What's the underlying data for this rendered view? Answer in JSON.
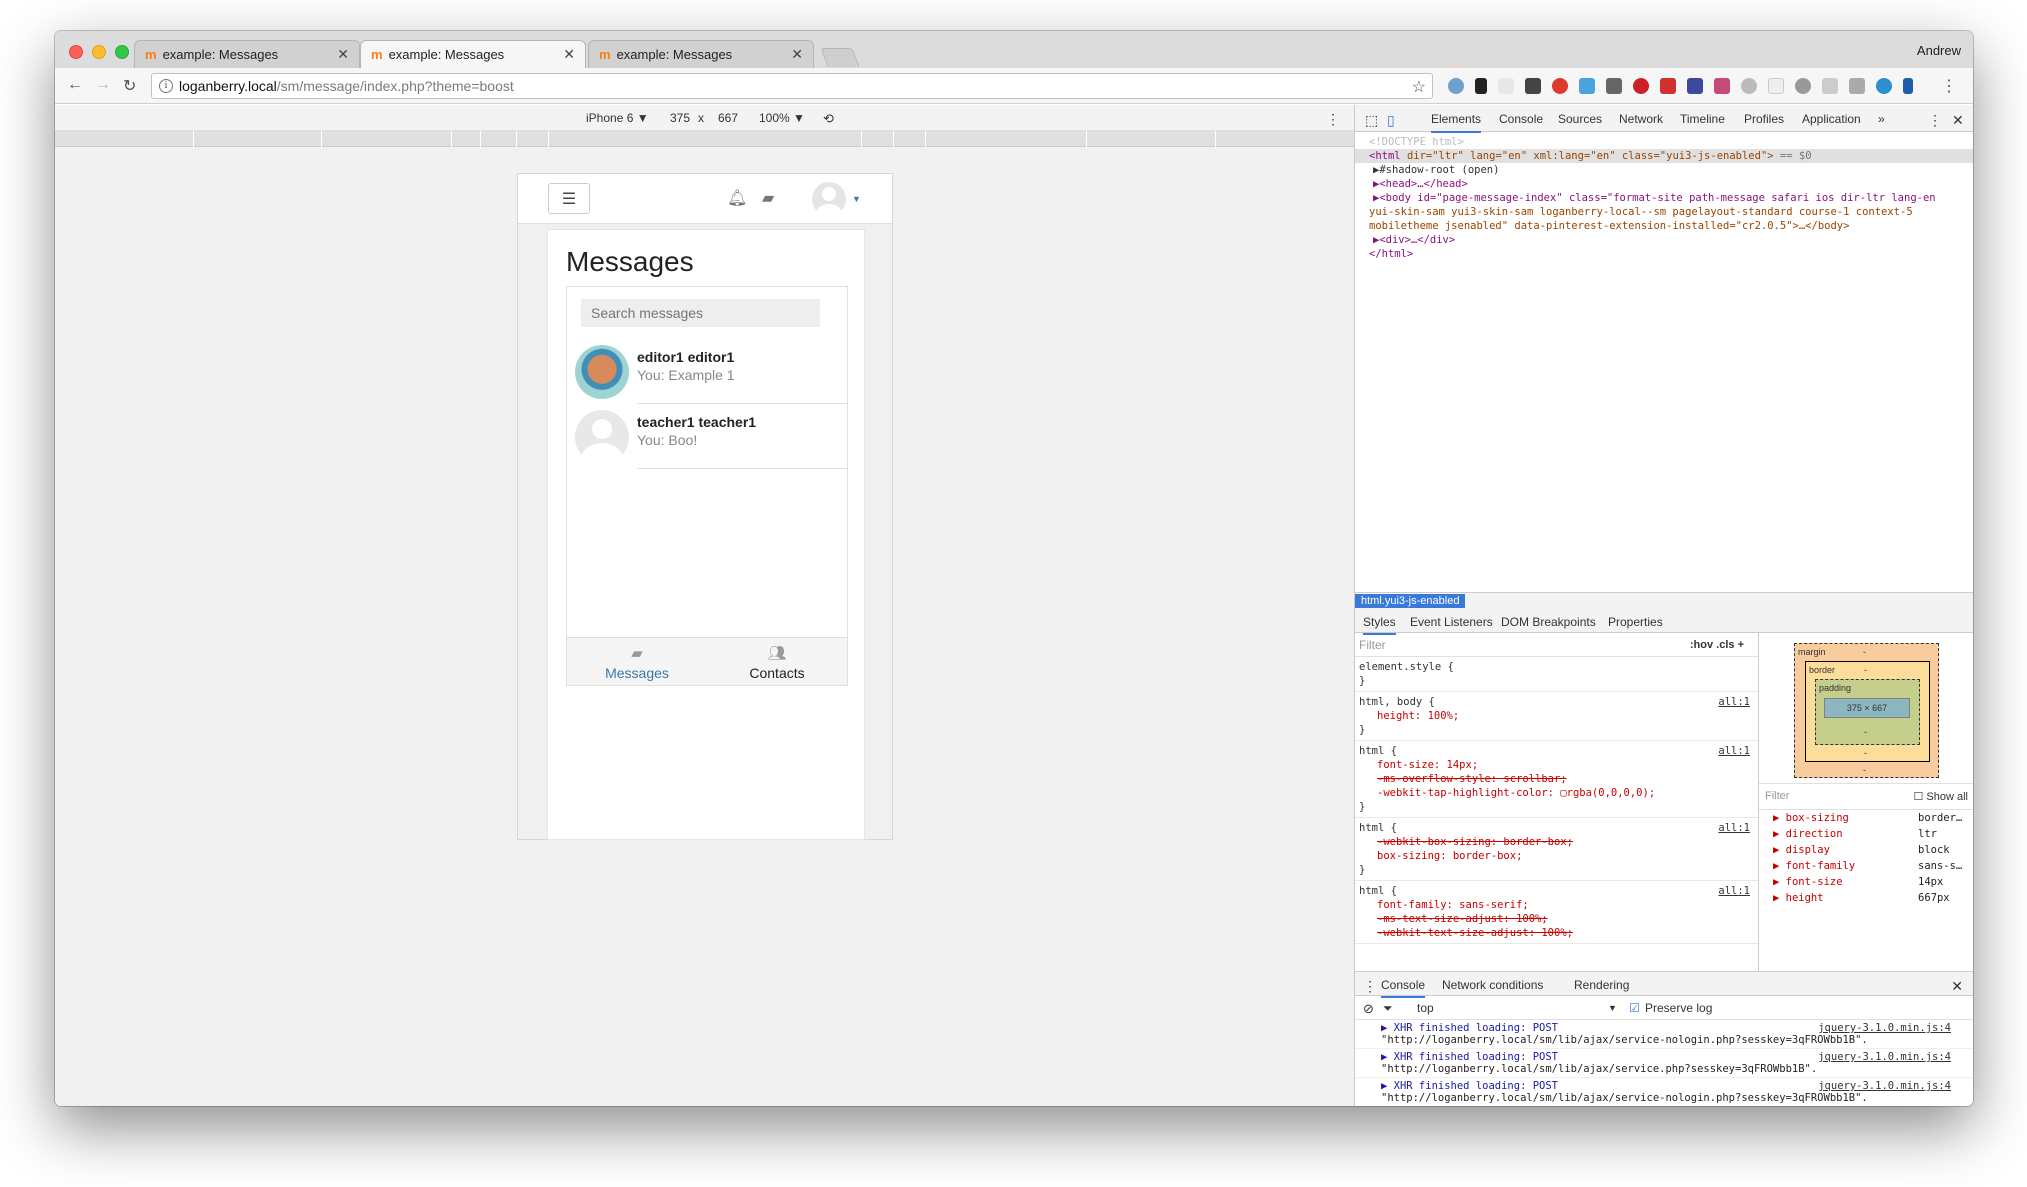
{
  "browser": {
    "tabs": [
      {
        "title": "example: Messages",
        "favicon": "moodle-icon"
      },
      {
        "title": "example: Messages",
        "favicon": "moodle-icon"
      },
      {
        "title": "example: Messages",
        "favicon": "moodle-icon"
      }
    ],
    "profile_name": "Andrew",
    "url_host": "loganberry.local",
    "url_path": "/sm/message/index.php?theme=boost"
  },
  "device_toolbar": {
    "device": "iPhone 6 ▼",
    "width": "375",
    "times": "x",
    "height": "667",
    "zoom": "100% ▼"
  },
  "page": {
    "title": "Messages",
    "search_placeholder": "Search messages",
    "conversations": [
      {
        "name": "editor1 editor1",
        "preview": "You: Example 1"
      },
      {
        "name": "teacher1 teacher1",
        "preview": "You: Boo!"
      }
    ],
    "bottom_tabs": {
      "messages": "Messages",
      "contacts": "Contacts"
    }
  },
  "devtools": {
    "tabs": [
      "Elements",
      "Console",
      "Sources",
      "Network",
      "Timeline",
      "Profiles",
      "Application",
      "»"
    ],
    "dom": {
      "doctype": "<!DOCTYPE html>",
      "html_open": "<html",
      "html_attrs": "dir=\"ltr\" lang=\"en\" xml:lang=\"en\" class=\"yui3-js-enabled\">",
      "html_eq": "== $0",
      "shadow": "▶#shadow-root (open)",
      "head": "▶<head>…</head>",
      "body1": "▶<body id=\"page-message-index\" class=\"format-site  path-message safari ios dir-ltr lang-en",
      "body2": "yui-skin-sam yui3-skin-sam loganberry-local--sm pagelayout-standard course-1 context-5",
      "body3": "mobiletheme  jsenabled\" data-pinterest-extension-installed=\"cr2.0.5\">…</body>",
      "div": "▶<div>…</div>",
      "html_close": "</html>"
    },
    "breadcrumb": "html.yui3-js-enabled",
    "sub_tabs": [
      "Styles",
      "Event Listeners",
      "DOM Breakpoints",
      "Properties"
    ],
    "styles_filter": "Filter",
    "styles_filter_tools": ":hov  .cls  +",
    "rules": [
      {
        "selector": "element.style {",
        "source": ""
      },
      {
        "selector": "html, body {",
        "source": "all:1"
      },
      {
        "selector": "html {",
        "source": "all:1"
      },
      {
        "selector": "html {",
        "source": "all:1"
      },
      {
        "selector": "html {",
        "source": "all:1"
      }
    ],
    "rule_lines": {
      "r2a": "height: 100%;",
      "r3a": "font-size: 14px;",
      "r3b": "-ms-overflow-style: scrollbar;",
      "r3c": "-webkit-tap-highlight-color: ▢rgba(0,0,0,0);",
      "r4a": "-webkit-box-sizing: border-box;",
      "r4b": "box-sizing: border-box;",
      "r5a": "font-family: sans-serif;",
      "r5b": "-ms-text-size-adjust: 100%;",
      "r5c": "-webkit-text-size-adjust: 100%;",
      "close": "}"
    },
    "box_model": {
      "margin": "margin",
      "border": "border",
      "padding": "padding",
      "content": "375 × 667",
      "dash": "-"
    },
    "computed_filter": "Filter",
    "show_all": "☐ Show all",
    "computed": [
      {
        "k": "▶ box-sizing",
        "v": "border…"
      },
      {
        "k": "▶ direction",
        "v": "ltr"
      },
      {
        "k": "▶ display",
        "v": "block"
      },
      {
        "k": "▶ font-family",
        "v": "sans-s…"
      },
      {
        "k": "▶ font-size",
        "v": "14px"
      },
      {
        "k": "▶ height",
        "v": "667px"
      }
    ],
    "drawer_tabs": [
      "Console",
      "Network conditions",
      "Rendering"
    ],
    "console_context": "top",
    "preserve_log": "Preserve log",
    "logs": [
      {
        "msg": "▶ XHR finished loading: POST",
        "url": "\"http://loganberry.local/sm/lib/ajax/service-nologin.php?sesskey=3qFROWbb1B\".",
        "src": "jquery-3.1.0.min.js:4"
      },
      {
        "msg": "▶ XHR finished loading: POST",
        "url": "\"http://loganberry.local/sm/lib/ajax/service.php?sesskey=3qFROWbb1B\".",
        "src": "jquery-3.1.0.min.js:4"
      },
      {
        "msg": "▶ XHR finished loading: POST",
        "url": "\"http://loganberry.local/sm/lib/ajax/service-nologin.php?sesskey=3qFROWbb1B\".",
        "src": "jquery-3.1.0.min.js:4"
      }
    ],
    "prompt": ">"
  },
  "colors": {
    "accent": "#3879d9",
    "link": "#3a76a8",
    "moodle": "#f98012"
  }
}
